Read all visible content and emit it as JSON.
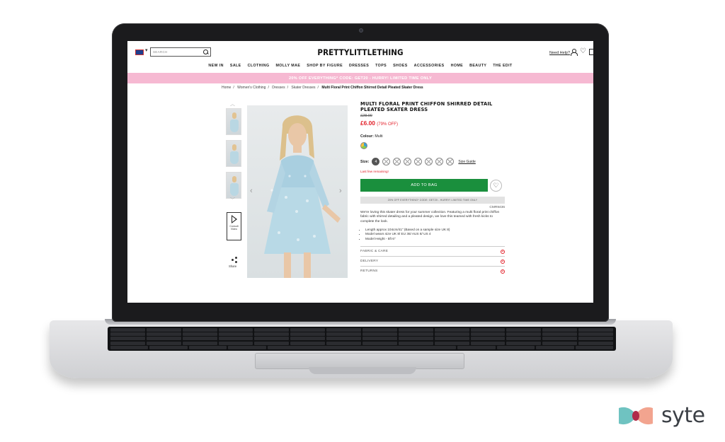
{
  "header": {
    "search_placeholder": "SEARCH",
    "logo": "PRETTYLITTLETHING",
    "help": "Need Help?"
  },
  "nav": [
    "NEW IN",
    "SALE",
    "CLOTHING",
    "MOLLY MAE",
    "SHOP BY FIGURE",
    "DRESSES",
    "TOPS",
    "SHOES",
    "ACCESSORIES",
    "HOME",
    "BEAUTY",
    "THE EDIT"
  ],
  "promo_bar": "20% OFF EVERYTHING* CODE: GET20 - HURRY! LIMITED TIME ONLY",
  "breadcrumb": [
    "Home",
    "Women's Clothing",
    "Dresses",
    "Skater Dresses",
    "Multi Floral Print Chiffon Shirred Detail Pleated Skater Dress"
  ],
  "gallery": {
    "video_label": "Consult Video",
    "share_label": "Share"
  },
  "product": {
    "title": "MULTI FLORAL PRINT CHIFFON SHIRRED DETAIL PLEATED SKATER DRESS",
    "was_price": "£28.00",
    "price": "£6.00",
    "discount": "(79% OFF)",
    "colour_label": "Colour:",
    "colour_value": "Multi",
    "size_label": "Size:",
    "sizes": [
      "4",
      "",
      "",
      "",
      "",
      "",
      "",
      ""
    ],
    "size_guide": "Size Guide",
    "stock_note": "Last few remaining!",
    "add_to_bag": "ADD TO BAG",
    "promo_box": "20% OFF EVERYTHING* CODE: GET20 - HURRY! LIMITED TIME ONLY",
    "code": "CMR9436",
    "description": "We're loving this skater dress for your summer collection. Featuring a multi floral print chiffon fabric with shirred detailing and a pleated design, we love this teamed with fresh kicks to complete the look.",
    "bullets": [
      "Length approx 104cm/41\" (Based on a sample size UK 8)",
      "Model wears size UK 8/ EU 36/ AUS 8/ US 4",
      "Model Height - 5ft 6\""
    ],
    "accordions": [
      "FABRIC & CARE",
      "DELIVERY",
      "RETURNS"
    ]
  },
  "brand_watermark": "syte",
  "colors": {
    "promo_pink": "#f6b9d2",
    "price_red": "#e3232c",
    "cta_green": "#1a8f3d"
  }
}
